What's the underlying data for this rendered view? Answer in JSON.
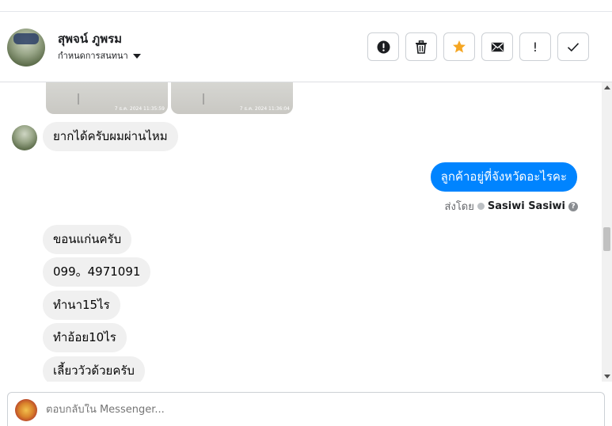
{
  "header": {
    "contact_name": "สุพจน์ ภูพรม",
    "subtitle": "กำหนดการสนทนา",
    "actions": [
      {
        "name": "report-icon",
        "glyph": "⚠"
      },
      {
        "name": "trash-icon",
        "glyph": "🗑"
      },
      {
        "name": "star-icon",
        "glyph": "★",
        "color": "#f5a623"
      },
      {
        "name": "mail-icon",
        "glyph": "✉"
      },
      {
        "name": "exclamation-icon",
        "glyph": "!"
      },
      {
        "name": "check-icon",
        "glyph": "✓"
      }
    ]
  },
  "images": [
    {
      "timestamp": "7 ธ.ค. 2024 11:35:59"
    },
    {
      "timestamp": "7 ธ.ค. 2024 11:36:04"
    }
  ],
  "messages": {
    "incoming_1": "ยากได้ครับผมผ่านไหม",
    "outgoing_1": "ลูกค้าอยู่ที่จังหวัดอะไรคะ",
    "sent_by_label": "ส่งโดย",
    "sent_by_name": "Sasiwi Sasiwi",
    "help_glyph": "?",
    "incoming_group": [
      "ขอนแก่นครับ",
      "099。4971091",
      "ทำนา15ไร",
      "ทำอ้อย10ไร",
      "เลี้ยววัวด้วยครับ"
    ]
  },
  "reply": {
    "placeholder": "ตอบกลับใน Messenger..."
  },
  "colors": {
    "outgoing_bubble": "#0084ff",
    "incoming_bubble": "#f0f0f0",
    "star": "#f5a623"
  }
}
